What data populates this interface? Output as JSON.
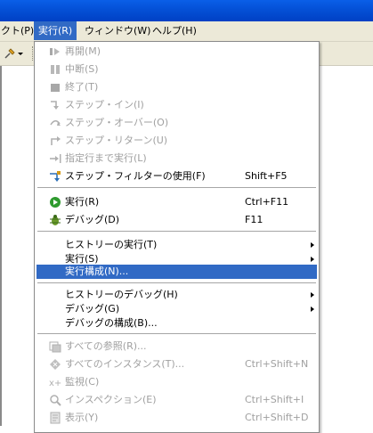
{
  "menubar": {
    "items": [
      "クト(P)",
      "実行(R)",
      "ウィンドウ(W)",
      "ヘルプ(H)"
    ],
    "active_index": 1
  },
  "run_menu": {
    "items": [
      {
        "label": "再開(M)",
        "shortcut": "",
        "icon": "resume-icon",
        "enabled": false,
        "submenu": false
      },
      {
        "label": "中断(S)",
        "shortcut": "",
        "icon": "suspend-icon",
        "enabled": false,
        "submenu": false
      },
      {
        "label": "終了(T)",
        "shortcut": "",
        "icon": "terminate-icon",
        "enabled": false,
        "submenu": false
      },
      {
        "label": "ステップ・イン(I)",
        "shortcut": "",
        "icon": "step-into-icon",
        "enabled": false,
        "submenu": false
      },
      {
        "label": "ステップ・オーバー(O)",
        "shortcut": "",
        "icon": "step-over-icon",
        "enabled": false,
        "submenu": false
      },
      {
        "label": "ステップ・リターン(U)",
        "shortcut": "",
        "icon": "step-return-icon",
        "enabled": false,
        "submenu": false
      },
      {
        "label": "指定行まで実行(L)",
        "shortcut": "",
        "icon": "run-to-line-icon",
        "enabled": false,
        "submenu": false
      },
      {
        "label": "ステップ・フィルターの使用(F)",
        "shortcut": "Shift+F5",
        "icon": "step-filter-icon",
        "enabled": true,
        "submenu": false
      },
      {
        "label": "実行(R)",
        "shortcut": "Ctrl+F11",
        "icon": "run-icon",
        "enabled": true,
        "submenu": false
      },
      {
        "label": "デバッグ(D)",
        "shortcut": "F11",
        "icon": "debug-icon",
        "enabled": true,
        "submenu": false
      },
      {
        "label": "ヒストリーの実行(T)",
        "shortcut": "",
        "icon": "",
        "enabled": true,
        "submenu": true
      },
      {
        "label": "実行(S)",
        "shortcut": "",
        "icon": "",
        "enabled": true,
        "submenu": true
      },
      {
        "label": "実行構成(N)...",
        "shortcut": "",
        "icon": "",
        "enabled": true,
        "submenu": false,
        "selected": true
      },
      {
        "label": "ヒストリーのデバッグ(H)",
        "shortcut": "",
        "icon": "",
        "enabled": true,
        "submenu": true
      },
      {
        "label": "デバッグ(G)",
        "shortcut": "",
        "icon": "",
        "enabled": true,
        "submenu": true
      },
      {
        "label": "デバッグの構成(B)...",
        "shortcut": "",
        "icon": "",
        "enabled": true,
        "submenu": false
      },
      {
        "label": "すべての参照(R)...",
        "shortcut": "",
        "icon": "all-references-icon",
        "enabled": false,
        "submenu": false
      },
      {
        "label": "すべてのインスタンス(T)...",
        "shortcut": "Ctrl+Shift+N",
        "icon": "all-instances-icon",
        "enabled": false,
        "submenu": false
      },
      {
        "label": "監視(C)",
        "shortcut": "",
        "icon": "watch-icon",
        "enabled": false,
        "submenu": false
      },
      {
        "label": "インスペクション(E)",
        "shortcut": "Ctrl+Shift+I",
        "icon": "inspect-icon",
        "enabled": false,
        "submenu": false
      },
      {
        "label": "表示(Y)",
        "shortcut": "Ctrl+Shift+D",
        "icon": "display-icon",
        "enabled": false,
        "submenu": false
      }
    ]
  },
  "colors": {
    "selection": "#316ac5",
    "disabled_text": "#a0a0a0",
    "title_bar": "#0450d6",
    "menubar_bg": "#ece9d8"
  }
}
